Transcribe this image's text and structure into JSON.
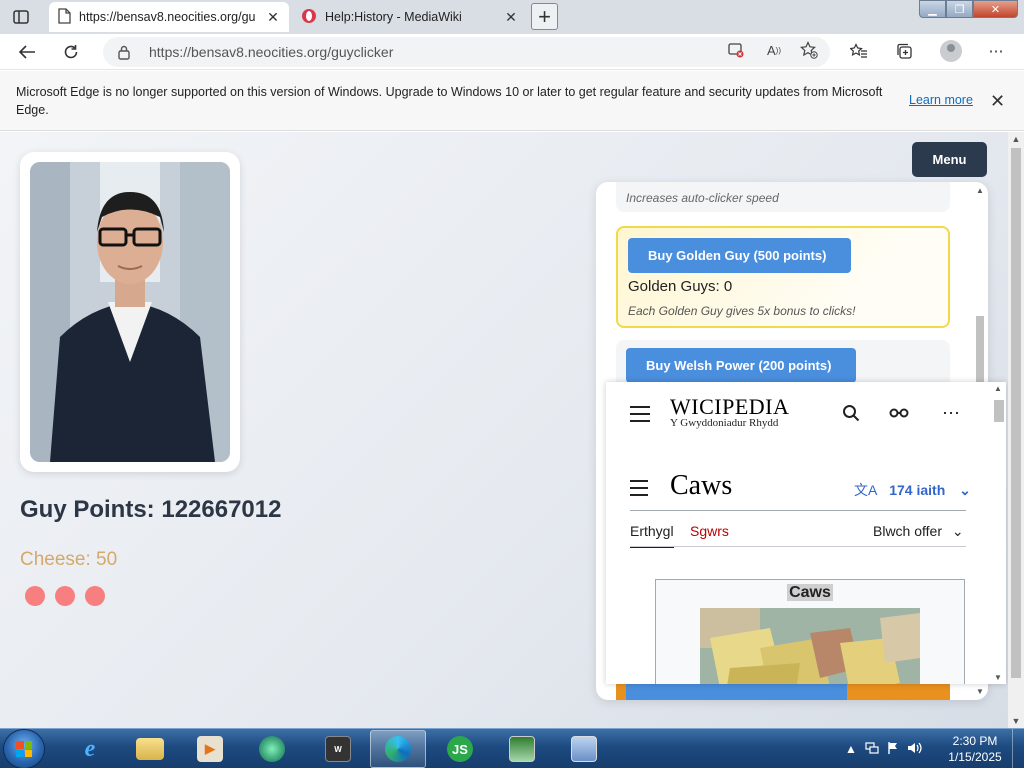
{
  "browser": {
    "tabs": [
      {
        "title": "https://bensav8.neocities.org/gu",
        "active": true
      },
      {
        "title": "Help:History - MediaWiki",
        "active": false
      }
    ],
    "new_tab_label": "+",
    "address": "https://bensav8.neocities.org/guyclicker",
    "read_aloud_label": "A"
  },
  "infobar": {
    "message": "Microsoft Edge is no longer supported on this version of Windows. Upgrade to Windows 10 or later to get regular feature and security updates from Microsoft Edge.",
    "link": "Learn more"
  },
  "game": {
    "points_label": "Guy Points: 122667012",
    "cheese_label": "Cheese: 50",
    "menu_label": "Menu",
    "shop": {
      "top_item_desc": "Increases auto-clicker speed",
      "golden": {
        "button": "Buy Golden Guy (500 points)",
        "count": "Golden Guys: 0",
        "desc": "Each Golden Guy gives 5x bonus to clicks!"
      },
      "welsh": {
        "button": "Buy Welsh Power (200 points)"
      }
    }
  },
  "wiki": {
    "logo": "WICIPEDIA",
    "tagline": "Y Gwyddoniadur Rhydd",
    "title": "Caws",
    "languages": "174 iaith",
    "tab_article": "Erthygl",
    "tab_talk": "Sgwrs",
    "tools": "Blwch offer",
    "infobox_caption": "Caws"
  },
  "taskbar": {
    "time": "2:30 PM",
    "date": "1/15/2025",
    "js_label": "JS"
  },
  "colors": {
    "accent_blue": "#4a8ede",
    "menu_dark": "#2c3a4d",
    "cheese_text": "#d4a96a",
    "golden_border": "#f0d94a",
    "wiki_link": "#3366cc",
    "wiki_red_link": "#ba0000"
  }
}
